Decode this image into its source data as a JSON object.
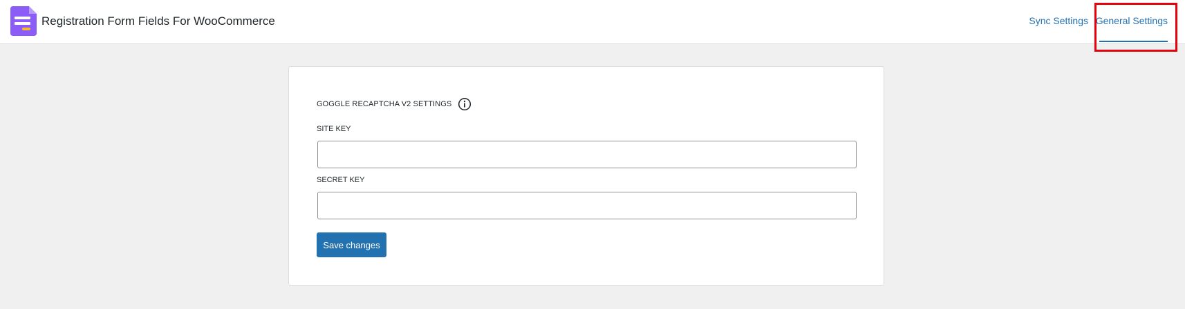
{
  "header": {
    "title": "Registration Form Fields For WooCommerce",
    "logo_icon": "form-document-icon",
    "brand_color": "#8c5cf6"
  },
  "nav": {
    "tabs": [
      {
        "label": "Sync Settings",
        "active": false
      },
      {
        "label": "General Settings",
        "active": true
      }
    ],
    "accent_color": "#2271b1",
    "highlight_color": "#e8000b"
  },
  "settings": {
    "section_title": "GOGGLE RECAPTCHA V2 SETTINGS",
    "info_icon": "info-icon",
    "site_key": {
      "label": "SITE KEY",
      "value": "",
      "placeholder": ""
    },
    "secret_key": {
      "label": "SECRET KEY",
      "value": "",
      "placeholder": ""
    },
    "save_label": "Save changes"
  }
}
